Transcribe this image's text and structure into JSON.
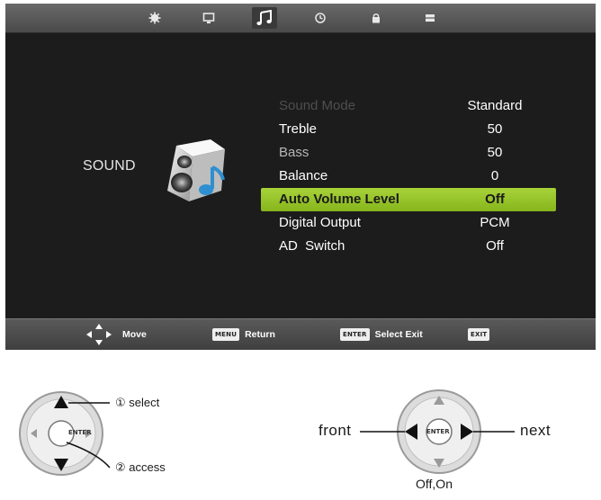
{
  "tabs": [
    {
      "icon": "picture-icon"
    },
    {
      "icon": "screen-icon"
    },
    {
      "icon": "music-note-icon",
      "active": true
    },
    {
      "icon": "clock-icon"
    },
    {
      "icon": "lock-icon"
    },
    {
      "icon": "setup-icon"
    }
  ],
  "section": {
    "label": "SOUND",
    "icon": "speaker-icon"
  },
  "menu": {
    "items": [
      {
        "label": "Sound Mode",
        "value": "Standard",
        "state": "disabled"
      },
      {
        "label": "Treble",
        "value": "50",
        "state": "normal"
      },
      {
        "label": "Bass",
        "value": "50",
        "state": "faded"
      },
      {
        "label": "Balance",
        "value": "0",
        "state": "normal"
      },
      {
        "label": "Auto Volume Level",
        "value": "Off",
        "state": "selected"
      },
      {
        "label": "Digital Output",
        "value": "PCM",
        "state": "normal"
      },
      {
        "label": "AD  Switch",
        "value": "Off",
        "state": "normal"
      }
    ],
    "highlight_color": "#99c42b"
  },
  "bottombar": {
    "move": {
      "label": "Move",
      "icon": "dpad-arrows-icon"
    },
    "return": {
      "key": "MENU",
      "label": "Return"
    },
    "select": {
      "key": "ENTER",
      "label": "Select Exit"
    },
    "exit": {
      "key": "EXIT"
    }
  },
  "diagram_left": {
    "center_key": "ENTER",
    "select_label": "① select",
    "access_label": "② access"
  },
  "diagram_right": {
    "center_key": "ENTER",
    "front_label": "front",
    "next_label": "next",
    "bottom_label": "Off,On"
  }
}
